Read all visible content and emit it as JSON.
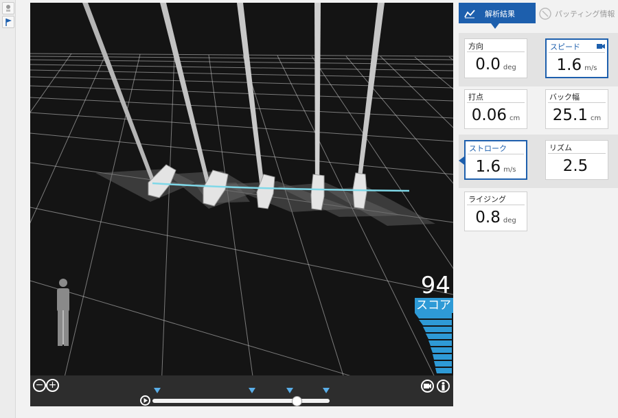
{
  "panel": {
    "tabs": [
      {
        "label": "解析結果",
        "active": true,
        "icon": "line-chart-icon"
      },
      {
        "label": "パッティング情報",
        "active": false,
        "icon": "putter-icon"
      }
    ],
    "metrics": [
      {
        "key": "direction",
        "label": "方向",
        "value": "0.0",
        "unit": "deg",
        "selected": false
      },
      {
        "key": "speed",
        "label": "スピード",
        "value": "1.6",
        "unit": "m/s",
        "selected": true,
        "icon": "camera-icon"
      },
      {
        "key": "impact",
        "label": "打点",
        "value": "0.06",
        "unit": "cm",
        "selected": false
      },
      {
        "key": "backswing",
        "label": "バック幅",
        "value": "25.1",
        "unit": "cm",
        "selected": false
      },
      {
        "key": "stroke",
        "label": "ストローク",
        "value": "1.6",
        "unit": "m/s",
        "selected": true
      },
      {
        "key": "rhythm",
        "label": "リズム",
        "value": "2.5",
        "unit": "",
        "selected": false
      },
      {
        "key": "rising",
        "label": "ライジング",
        "value": "0.8",
        "unit": "deg",
        "selected": false
      }
    ]
  },
  "viewer": {
    "score_value": "94",
    "score_label": "スコア",
    "zoom_out_icon": "minus-circle-icon",
    "zoom_in_icon": "plus-circle-icon",
    "play_icon": "play-icon",
    "camera_view_icon": "camera-view-icon",
    "person_view_icon": "person-view-icon",
    "timeline_position": 0.83
  },
  "colors": {
    "accent": "#1d5fad",
    "score_blue": "#2e9ad6",
    "path_line": "#7fd8e8",
    "viewport_bg": "#141414"
  }
}
